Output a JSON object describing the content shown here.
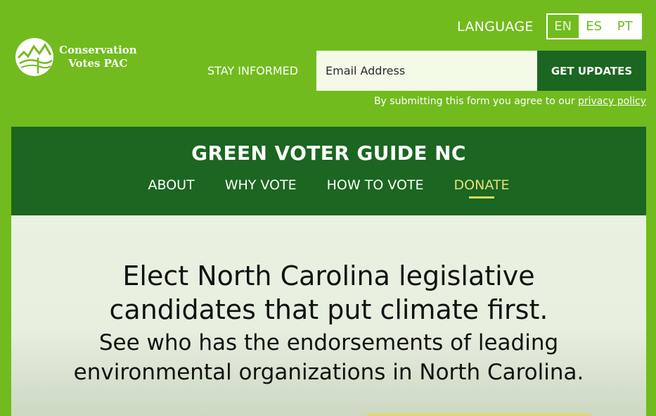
{
  "header": {
    "logo_line1": "Conservation",
    "logo_line2": "Votes PAC",
    "language_label": "LANGUAGE",
    "languages": [
      {
        "code": "EN",
        "active": true
      },
      {
        "code": "ES",
        "active": false
      },
      {
        "code": "PT",
        "active": false
      }
    ],
    "stay_informed": "STAY INFORMED",
    "email_placeholder": "Email Address",
    "get_updates": "GET UPDATES",
    "agree_text": "By submitting this form you agree to our ",
    "privacy_link": "privacy policy"
  },
  "guide": {
    "title": "GREEN VOTER GUIDE NC",
    "nav": [
      {
        "label": "ABOUT",
        "highlight": false
      },
      {
        "label": "WHY VOTE",
        "highlight": false
      },
      {
        "label": "HOW TO VOTE",
        "highlight": false
      },
      {
        "label": "DONATE",
        "highlight": true
      }
    ]
  },
  "hero": {
    "headline_line1": "Elect North Carolina legislative",
    "headline_line2": "candidates that put climate first.",
    "sub_line1": "See who has the endorsements of leading",
    "sub_line2": "environmental organizations in North Carolina."
  },
  "colors": {
    "brand_green": "#71bb1e",
    "dark_green": "#1b6620",
    "accent_yellow": "#e6d75a"
  }
}
